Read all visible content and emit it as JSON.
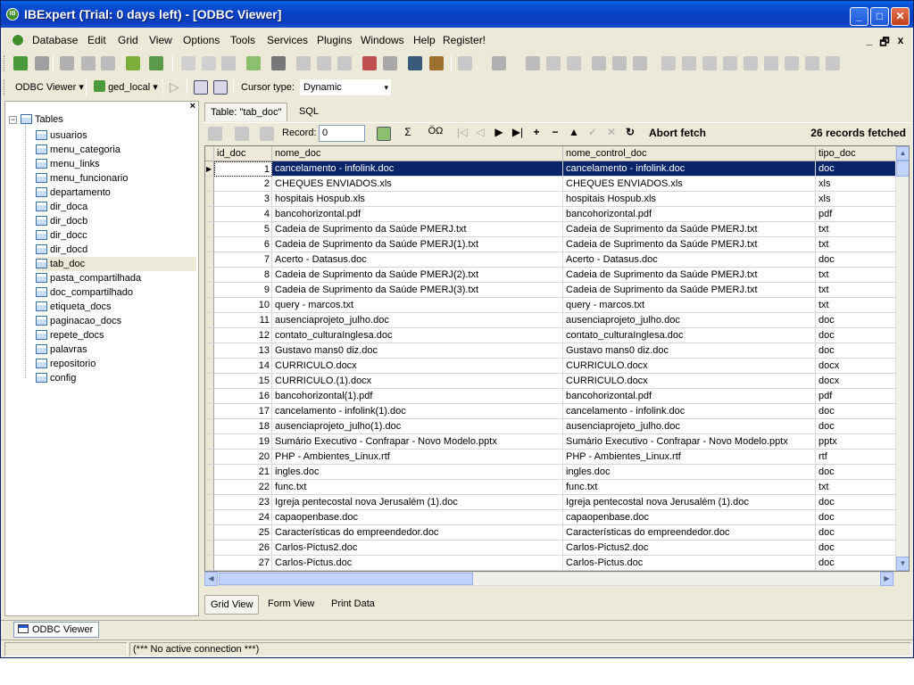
{
  "window": {
    "title": "IBExpert (Trial: 0 days left) - [ODBC Viewer]",
    "controls": {
      "minimize": "_",
      "maximize": "□",
      "close": "✕"
    }
  },
  "menu": {
    "items": [
      "Database",
      "Edit",
      "Grid",
      "View",
      "Options",
      "Tools",
      "Services",
      "Plugins",
      "Windows",
      "Help",
      "Register!"
    ],
    "mdi": {
      "minimize": "_",
      "restore": "🗗",
      "close": "x"
    }
  },
  "toolbar2": {
    "odbc_viewer": "ODBC Viewer",
    "database": "ged_local",
    "cursor_type_label": "Cursor type:",
    "cursor_type_value": "Dynamic"
  },
  "tree": {
    "root": "Tables",
    "items": [
      "usuarios",
      "menu_categoria",
      "menu_links",
      "menu_funcionario",
      "departamento",
      "dir_doca",
      "dir_docb",
      "dir_docc",
      "dir_docd",
      "tab_doc",
      "pasta_compartilhada",
      "doc_compartilhado",
      "etiqueta_docs",
      "paginacao_docs",
      "repete_docs",
      "palavras",
      "repositorio",
      "config"
    ],
    "selected": "tab_doc",
    "close": "×"
  },
  "tabs": {
    "table": "Table: \"tab_doc\"",
    "sql": "SQL"
  },
  "grid_toolbar": {
    "record_label": "Record:",
    "record_value": "0",
    "abort_fetch": "Abort fetch",
    "records_fetched": "26 records fetched"
  },
  "grid": {
    "columns": [
      "id_doc",
      "nome_doc",
      "nome_control_doc",
      "tipo_doc"
    ],
    "rows": [
      [
        "1",
        "cancelamento - infolink.doc",
        "cancelamento - infolink.doc",
        "doc"
      ],
      [
        "2",
        "CHEQUES ENVIADOS.xls",
        "CHEQUES ENVIADOS.xls",
        "xls"
      ],
      [
        "3",
        "hospitais Hospub.xls",
        "hospitais Hospub.xls",
        "xls"
      ],
      [
        "4",
        "bancohorizontal.pdf",
        "bancohorizontal.pdf",
        "pdf"
      ],
      [
        "5",
        "Cadeia de Suprimento da Saúde PMERJ.txt",
        "Cadeia de Suprimento da Saúde PMERJ.txt",
        "txt"
      ],
      [
        "6",
        "Cadeia de Suprimento da Saúde PMERJ(1).txt",
        "Cadeia de Suprimento da Saúde PMERJ.txt",
        "txt"
      ],
      [
        "7",
        "Acerto - Datasus.doc",
        "Acerto - Datasus.doc",
        "doc"
      ],
      [
        "8",
        "Cadeia de Suprimento da Saúde PMERJ(2).txt",
        "Cadeia de Suprimento da Saúde PMERJ.txt",
        "txt"
      ],
      [
        "9",
        "Cadeia de Suprimento da Saúde PMERJ(3).txt",
        "Cadeia de Suprimento da Saúde PMERJ.txt",
        "txt"
      ],
      [
        "10",
        "query - marcos.txt",
        "query - marcos.txt",
        "txt"
      ],
      [
        "11",
        "ausenciaprojeto_julho.doc",
        "ausenciaprojeto_julho.doc",
        "doc"
      ],
      [
        "12",
        "contato_culturaInglesa.doc",
        "contato_culturaInglesa.doc",
        "doc"
      ],
      [
        "13",
        "Gustavo mans0 diz.doc",
        "Gustavo mans0 diz.doc",
        "doc"
      ],
      [
        "14",
        "CURRICULO.docx",
        "CURRICULO.docx",
        "docx"
      ],
      [
        "15",
        "CURRICULO.(1).docx",
        "CURRICULO.docx",
        "docx"
      ],
      [
        "16",
        "bancohorizontal(1).pdf",
        "bancohorizontal.pdf",
        "pdf"
      ],
      [
        "17",
        "cancelamento - infolink(1).doc",
        "cancelamento - infolink.doc",
        "doc"
      ],
      [
        "18",
        "ausenciaprojeto_julho(1).doc",
        "ausenciaprojeto_julho.doc",
        "doc"
      ],
      [
        "19",
        "Sumário Executivo - Confrapar - Novo Modelo.pptx",
        "Sumário Executivo - Confrapar - Novo Modelo.pptx",
        "pptx"
      ],
      [
        "20",
        "PHP - Ambientes_Linux.rtf",
        "PHP - Ambientes_Linux.rtf",
        "rtf"
      ],
      [
        "21",
        "ingles.doc",
        "ingles.doc",
        "doc"
      ],
      [
        "22",
        "func.txt",
        "func.txt",
        "txt"
      ],
      [
        "23",
        "Igreja pentecostal nova Jerusalém (1).doc",
        "Igreja pentecostal nova Jerusalém (1).doc",
        "doc"
      ],
      [
        "24",
        "capaopenbase.doc",
        "capaopenbase.doc",
        "doc"
      ],
      [
        "25",
        "Características do empreendedor.doc",
        "Características do empreendedor.doc",
        "doc"
      ],
      [
        "26",
        "Carlos-Pictus2.doc",
        "Carlos-Pictus2.doc",
        "doc"
      ],
      [
        "27",
        "Carlos-Pictus.doc",
        "Carlos-Pictus.doc",
        "doc"
      ]
    ],
    "selected_row": 0,
    "current_row_marker": "▶"
  },
  "view_tabs": {
    "grid_view": "Grid View",
    "form_view": "Form View",
    "print_data": "Print Data"
  },
  "windowbar": {
    "odbc_viewer": "ODBC Viewer"
  },
  "status": {
    "connection": "(*** No active connection ***)"
  },
  "colors": {
    "title_bar": "#0a3ebd",
    "selection": "#0a246a",
    "chrome": "#ece9d8"
  }
}
